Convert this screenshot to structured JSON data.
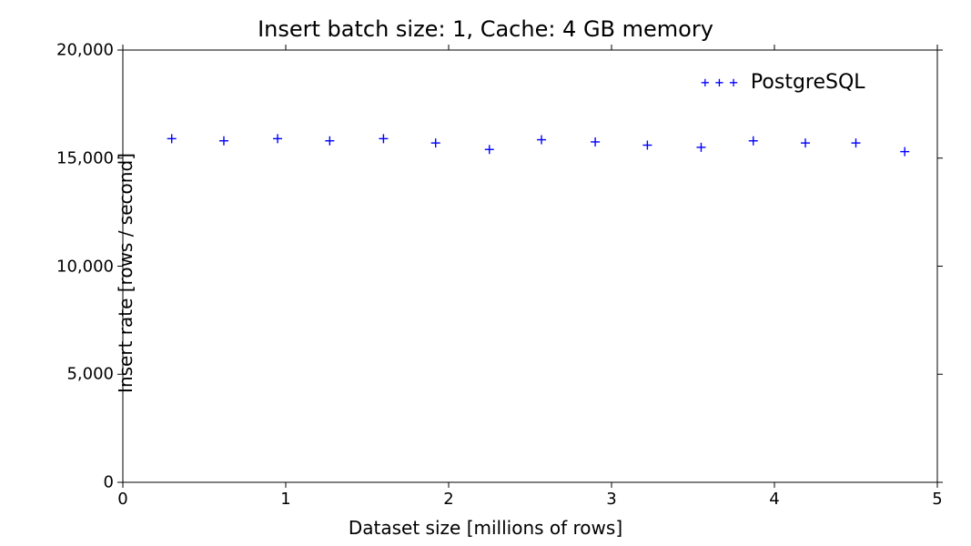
{
  "chart_data": {
    "type": "scatter",
    "title": "Insert batch size: 1,  Cache: 4 GB memory",
    "xlabel": "Dataset size [millions of rows]",
    "ylabel": "Insert rate [rows / second]",
    "xlim": [
      0,
      5
    ],
    "ylim": [
      0,
      20000
    ],
    "xticks": [
      0,
      1,
      2,
      3,
      4,
      5
    ],
    "ytick_values": [
      0,
      5000,
      10000,
      15000,
      20000
    ],
    "ytick_labels": [
      "0",
      "5,000",
      "10,000",
      "15,000",
      "20,000"
    ],
    "legend_position": "upper-right",
    "series": [
      {
        "name": "PostgreSQL",
        "marker": "plus",
        "color": "#0000ff",
        "x": [
          0.3,
          0.62,
          0.95,
          1.27,
          1.6,
          1.92,
          2.25,
          2.57,
          2.9,
          3.22,
          3.55,
          3.87,
          4.19,
          4.5,
          4.8
        ],
        "y": [
          15900,
          15800,
          15900,
          15800,
          15900,
          15700,
          15400,
          15850,
          15750,
          15600,
          15500,
          15800,
          15700,
          15700,
          15300
        ]
      }
    ]
  }
}
